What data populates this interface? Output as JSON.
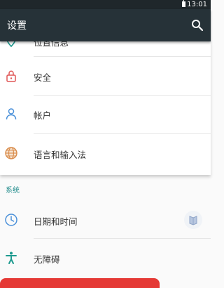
{
  "status_bar": {
    "time": "13:01"
  },
  "app_bar": {
    "title": "设置",
    "search_icon": "search-icon"
  },
  "settings_items": [
    {
      "label": "位置信息",
      "icon": "location-icon"
    },
    {
      "label": "安全",
      "icon": "lock-icon"
    },
    {
      "label": "帐户",
      "icon": "person-icon"
    },
    {
      "label": "语言和输入法",
      "icon": "globe-icon"
    }
  ],
  "system_section": {
    "header": "系统",
    "items": [
      {
        "label": "日期和时间",
        "icon": "clock-icon"
      },
      {
        "label": "无障碍",
        "icon": "accessibility-icon"
      }
    ]
  },
  "colors": {
    "app_bar": "#263238",
    "status_bar": "#1f272b",
    "accent": "#1e8a8a",
    "icon_red": "#e05757",
    "icon_blue": "#4a90d9",
    "icon_orange": "#d98b4a",
    "icon_teal": "#1e9a8f",
    "fab_red": "#e53935"
  }
}
